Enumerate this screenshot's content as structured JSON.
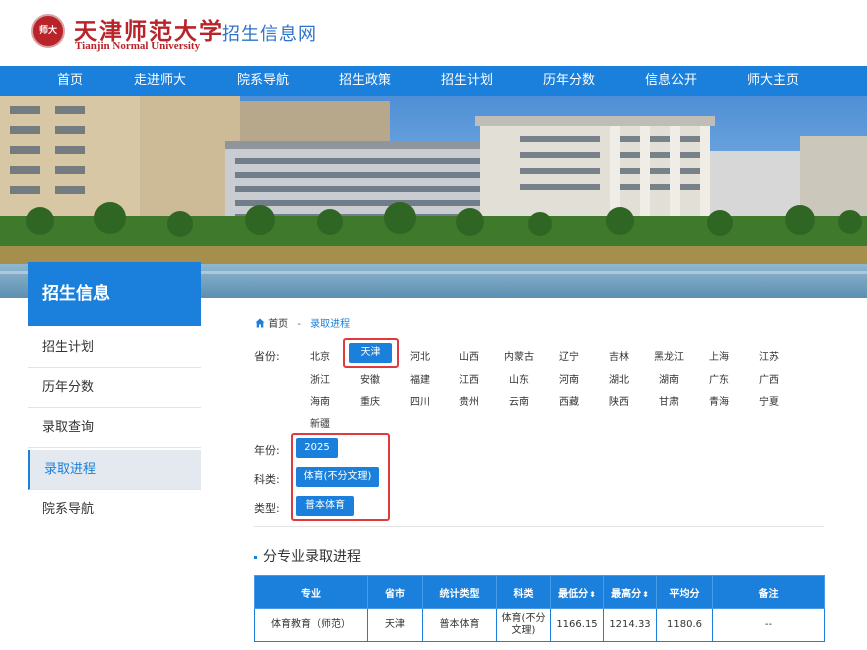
{
  "header": {
    "logo_cn": "天津师范大学",
    "logo_en": "Tianjin Normal University",
    "site_title": "招生信息网",
    "logo_seal_text": "师大"
  },
  "nav": [
    "首页",
    "走进师大",
    "院系导航",
    "招生政策",
    "招生计划",
    "历年分数",
    "信息公开",
    "师大主页"
  ],
  "sidebar": {
    "title": "招生信息",
    "items": [
      "招生计划",
      "历年分数",
      "录取查询",
      "录取进程",
      "院系导航"
    ],
    "active_index": 3
  },
  "breadcrumb": {
    "home": "首页",
    "sep": "-",
    "current": "录取进程"
  },
  "filters": {
    "province_label": "省份:",
    "provinces": [
      "北京",
      "天津",
      "河北",
      "山西",
      "内蒙古",
      "辽宁",
      "吉林",
      "黑龙江",
      "上海",
      "江苏",
      "浙江",
      "安徽",
      "福建",
      "江西",
      "山东",
      "河南",
      "湖北",
      "湖南",
      "广东",
      "广西",
      "海南",
      "重庆",
      "四川",
      "贵州",
      "云南",
      "西藏",
      "陕西",
      "甘肃",
      "青海",
      "宁夏",
      "新疆"
    ],
    "selected_province": "天津",
    "year_label": "年份:",
    "year": "2025",
    "subject_label": "科类:",
    "subject": "体育(不分文理)",
    "type_label": "类型:",
    "type": "普本体育"
  },
  "section_title": "分专业录取进程",
  "table": {
    "headers": [
      "专业",
      "省市",
      "统计类型",
      "科类",
      "最低分",
      "最高分",
      "平均分",
      "备注"
    ],
    "rows": [
      [
        "体育教育（师范）",
        "天津",
        "普本体育",
        "体育(不分文理)",
        "1166.15",
        "1214.33",
        "1180.6",
        "--"
      ]
    ]
  },
  "colors": {
    "primary": "#1a80dc",
    "brand_red": "#b8242a",
    "highlight_red": "#e0393e"
  }
}
